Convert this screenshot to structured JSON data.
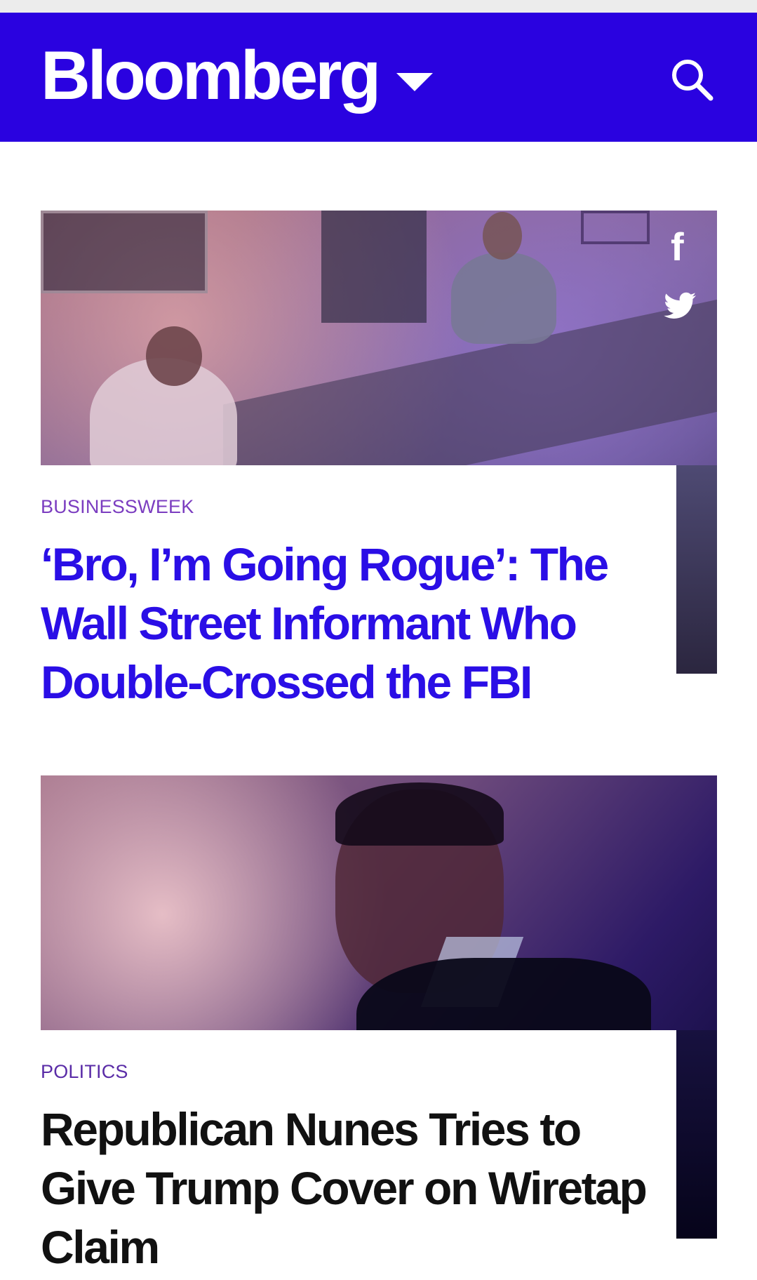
{
  "header": {
    "brand": "Bloomberg",
    "brand_color": "#2a02e0",
    "menu_icon": "caret-down-icon",
    "search_icon": "search-icon"
  },
  "articles": [
    {
      "section": "BUSINESSWEEK",
      "headline": "‘Bro, I’m Going Rogue’: The Wall Street Informant Who Double-Crossed the FBI",
      "headline_color": "#2a0ee6",
      "share": {
        "facebook_label": "f",
        "facebook_icon": "facebook-icon",
        "twitter_icon": "twitter-icon"
      }
    },
    {
      "section": "POLITICS",
      "headline": "Republican Nunes Tries to Give Trump Cover on Wiretap Claim",
      "headline_color": "#111111"
    }
  ]
}
